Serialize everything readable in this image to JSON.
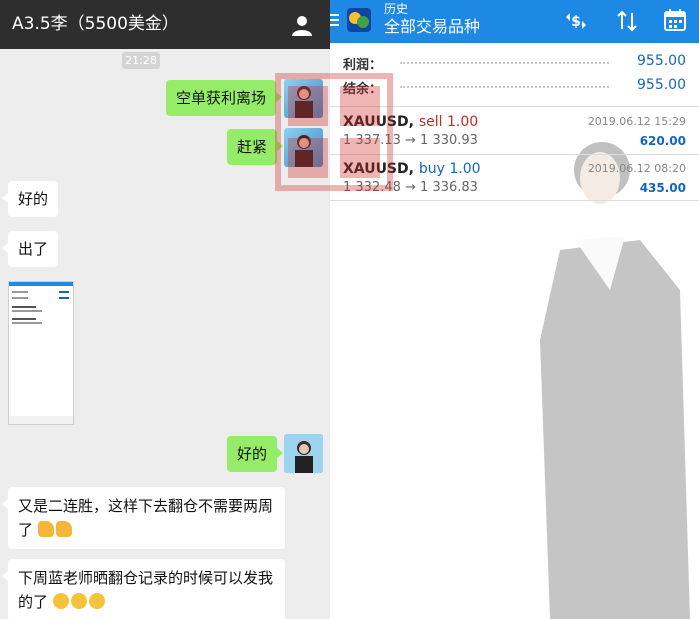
{
  "chat": {
    "title": "A3.5李（5500美金）",
    "time": "21:28",
    "messages": [
      {
        "text": "空单获利离场"
      },
      {
        "text": "赶紧"
      },
      {
        "text": "好的"
      },
      {
        "text": "出了"
      },
      {
        "text": "好的"
      },
      {
        "text": "又是二连胜，这样下去翻仓不需要两周了"
      },
      {
        "text": "下周蓝老师晒翻仓记录的时候可以发我的了"
      }
    ]
  },
  "mt4": {
    "subtitle": "历史",
    "title": "全部交易品种",
    "summary": {
      "profit_label": "利润：",
      "profit_value": "955.00",
      "balance_label": "结余：",
      "balance_value": "955.00"
    },
    "trades": [
      {
        "symbol": "XAUUSD,",
        "side": "sell 1.00",
        "prices": "1 337.13 → 1 330.93",
        "date": "2019.06.12 15:29",
        "profit": "620.00"
      },
      {
        "symbol": "XAUUSD,",
        "side": "buy 1.00",
        "prices": "1 332.48 → 1 336.83",
        "date": "2019.06.12 08:20",
        "profit": "435.00"
      }
    ]
  },
  "colors": {
    "chat_header": "#2e2e2e",
    "bubble_out": "#95ec69",
    "app_bar": "#1e88e5",
    "sell": "#c62828",
    "buy": "#1565c0"
  }
}
